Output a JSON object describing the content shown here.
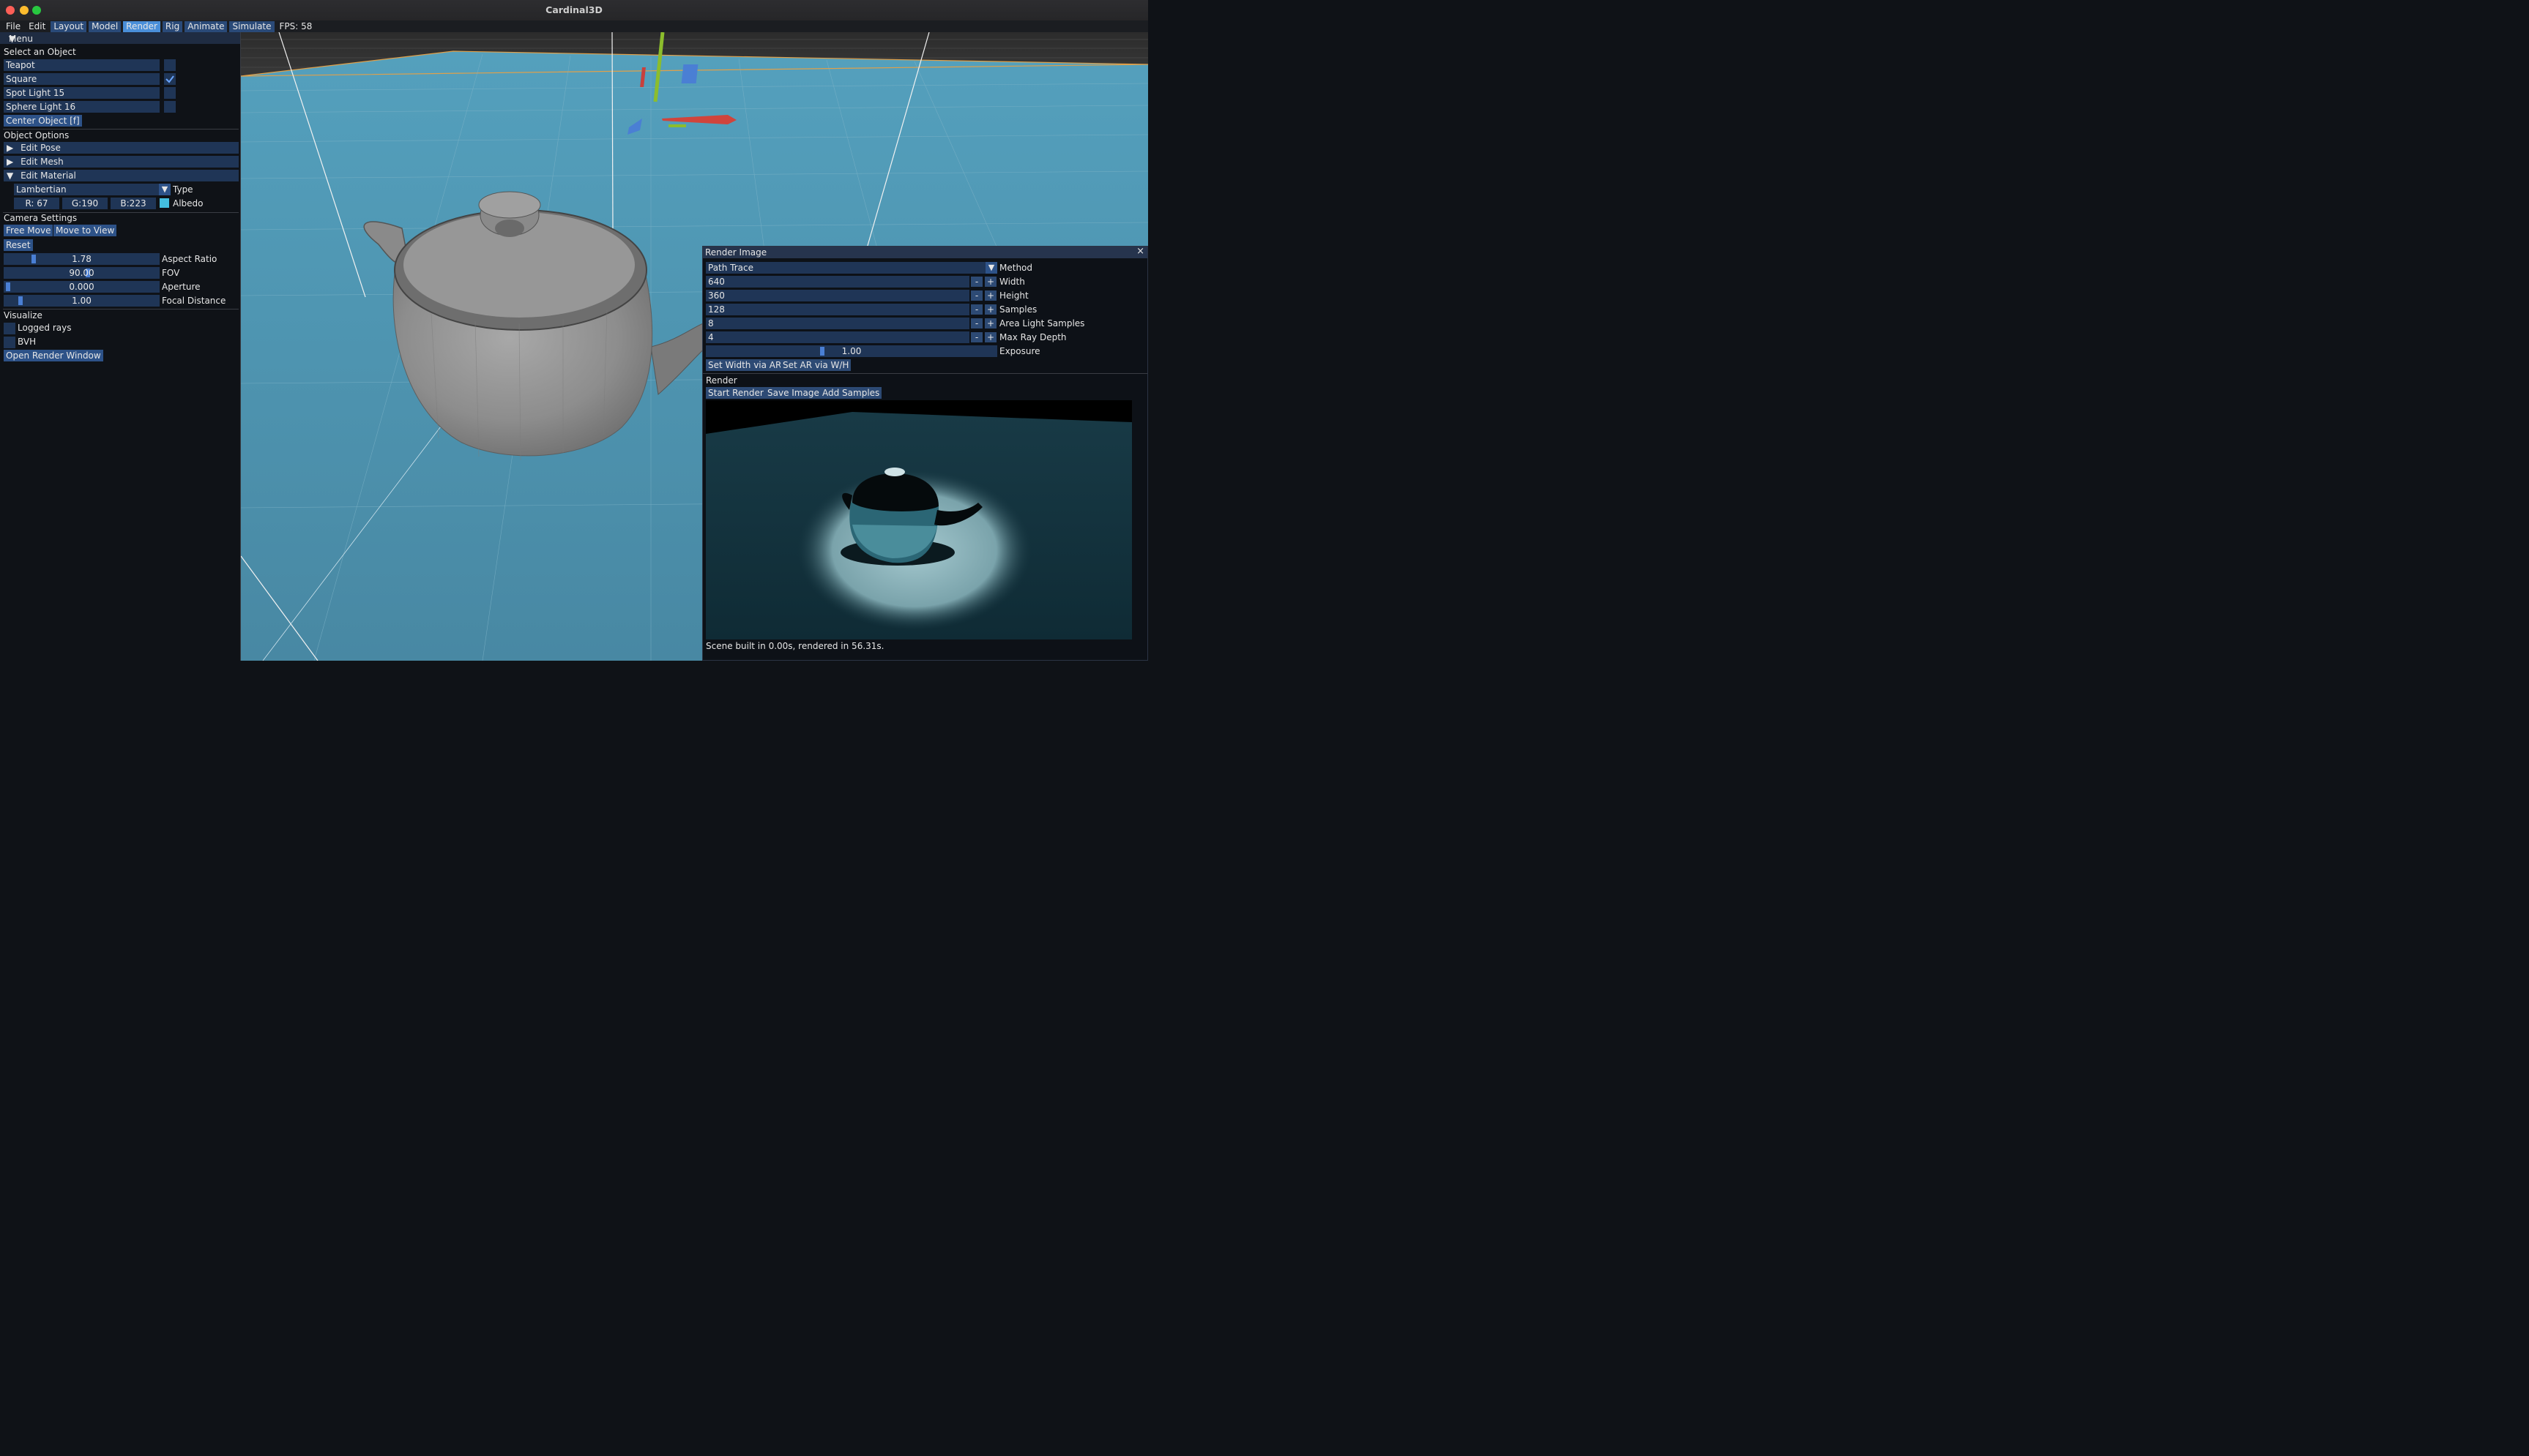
{
  "window": {
    "title": "Cardinal3D"
  },
  "menubar": {
    "items": [
      "File",
      "Edit",
      "Layout",
      "Model",
      "Render",
      "Rig",
      "Animate",
      "Simulate"
    ],
    "fps": "FPS: 58"
  },
  "leftpanel": {
    "header": "Menu",
    "select_title": "Select an Object",
    "objects": [
      {
        "name": "Teapot",
        "checked": false
      },
      {
        "name": "Square",
        "checked": true
      },
      {
        "name": "Spot Light 15",
        "checked": false
      },
      {
        "name": "Sphere Light 16",
        "checked": false
      }
    ],
    "center_object": "Center Object [f]",
    "object_options": "Object Options",
    "edit_pose": "Edit Pose",
    "edit_mesh": "Edit Mesh",
    "edit_material": "Edit Material",
    "material_type": "Lambertian",
    "type_label": "Type",
    "rgb": [
      "R: 67",
      "G:190",
      "B:223"
    ],
    "albedo_label": "Albedo",
    "albedo_color": "#43bedf",
    "camera_settings": "Camera Settings",
    "free_move": "Free Move",
    "move_to_view": "Move to View",
    "reset": "Reset",
    "camera_params": [
      {
        "value": "1.78",
        "label": "Aspect Ratio"
      },
      {
        "value": "90.00",
        "label": "FOV"
      },
      {
        "value": "0.000",
        "label": "Aperture"
      },
      {
        "value": "1.00",
        "label": "Focal Distance"
      }
    ],
    "visualize": "Visualize",
    "logged_rays": "Logged rays",
    "bvh": "BVH",
    "open_render_window": "Open Render Window"
  },
  "render_window": {
    "title": "Render Image",
    "close_icon": "×",
    "method_value": "Path Trace",
    "method_label": "Method",
    "params": [
      {
        "value": "640",
        "label": "Width"
      },
      {
        "value": "360",
        "label": "Height"
      },
      {
        "value": "128",
        "label": "Samples"
      },
      {
        "value": "8",
        "label": "Area Light Samples"
      },
      {
        "value": "4",
        "label": "Max Ray Depth"
      }
    ],
    "minus": "-",
    "plus": "+",
    "exposure_value": "1.00",
    "exposure_label": "Exposure",
    "set_width_ar": "Set Width via AR",
    "set_ar_wh": "Set AR via W/H",
    "render_label": "Render",
    "start_render": "Start Render",
    "save_image": "Save Image",
    "add_samples": "Add Samples",
    "status": "Scene built in 0.00s, rendered in 56.31s."
  },
  "colors": {
    "accent": "#4a8fd9",
    "floor": "#4a8ba8",
    "panel": "#0f1217"
  }
}
